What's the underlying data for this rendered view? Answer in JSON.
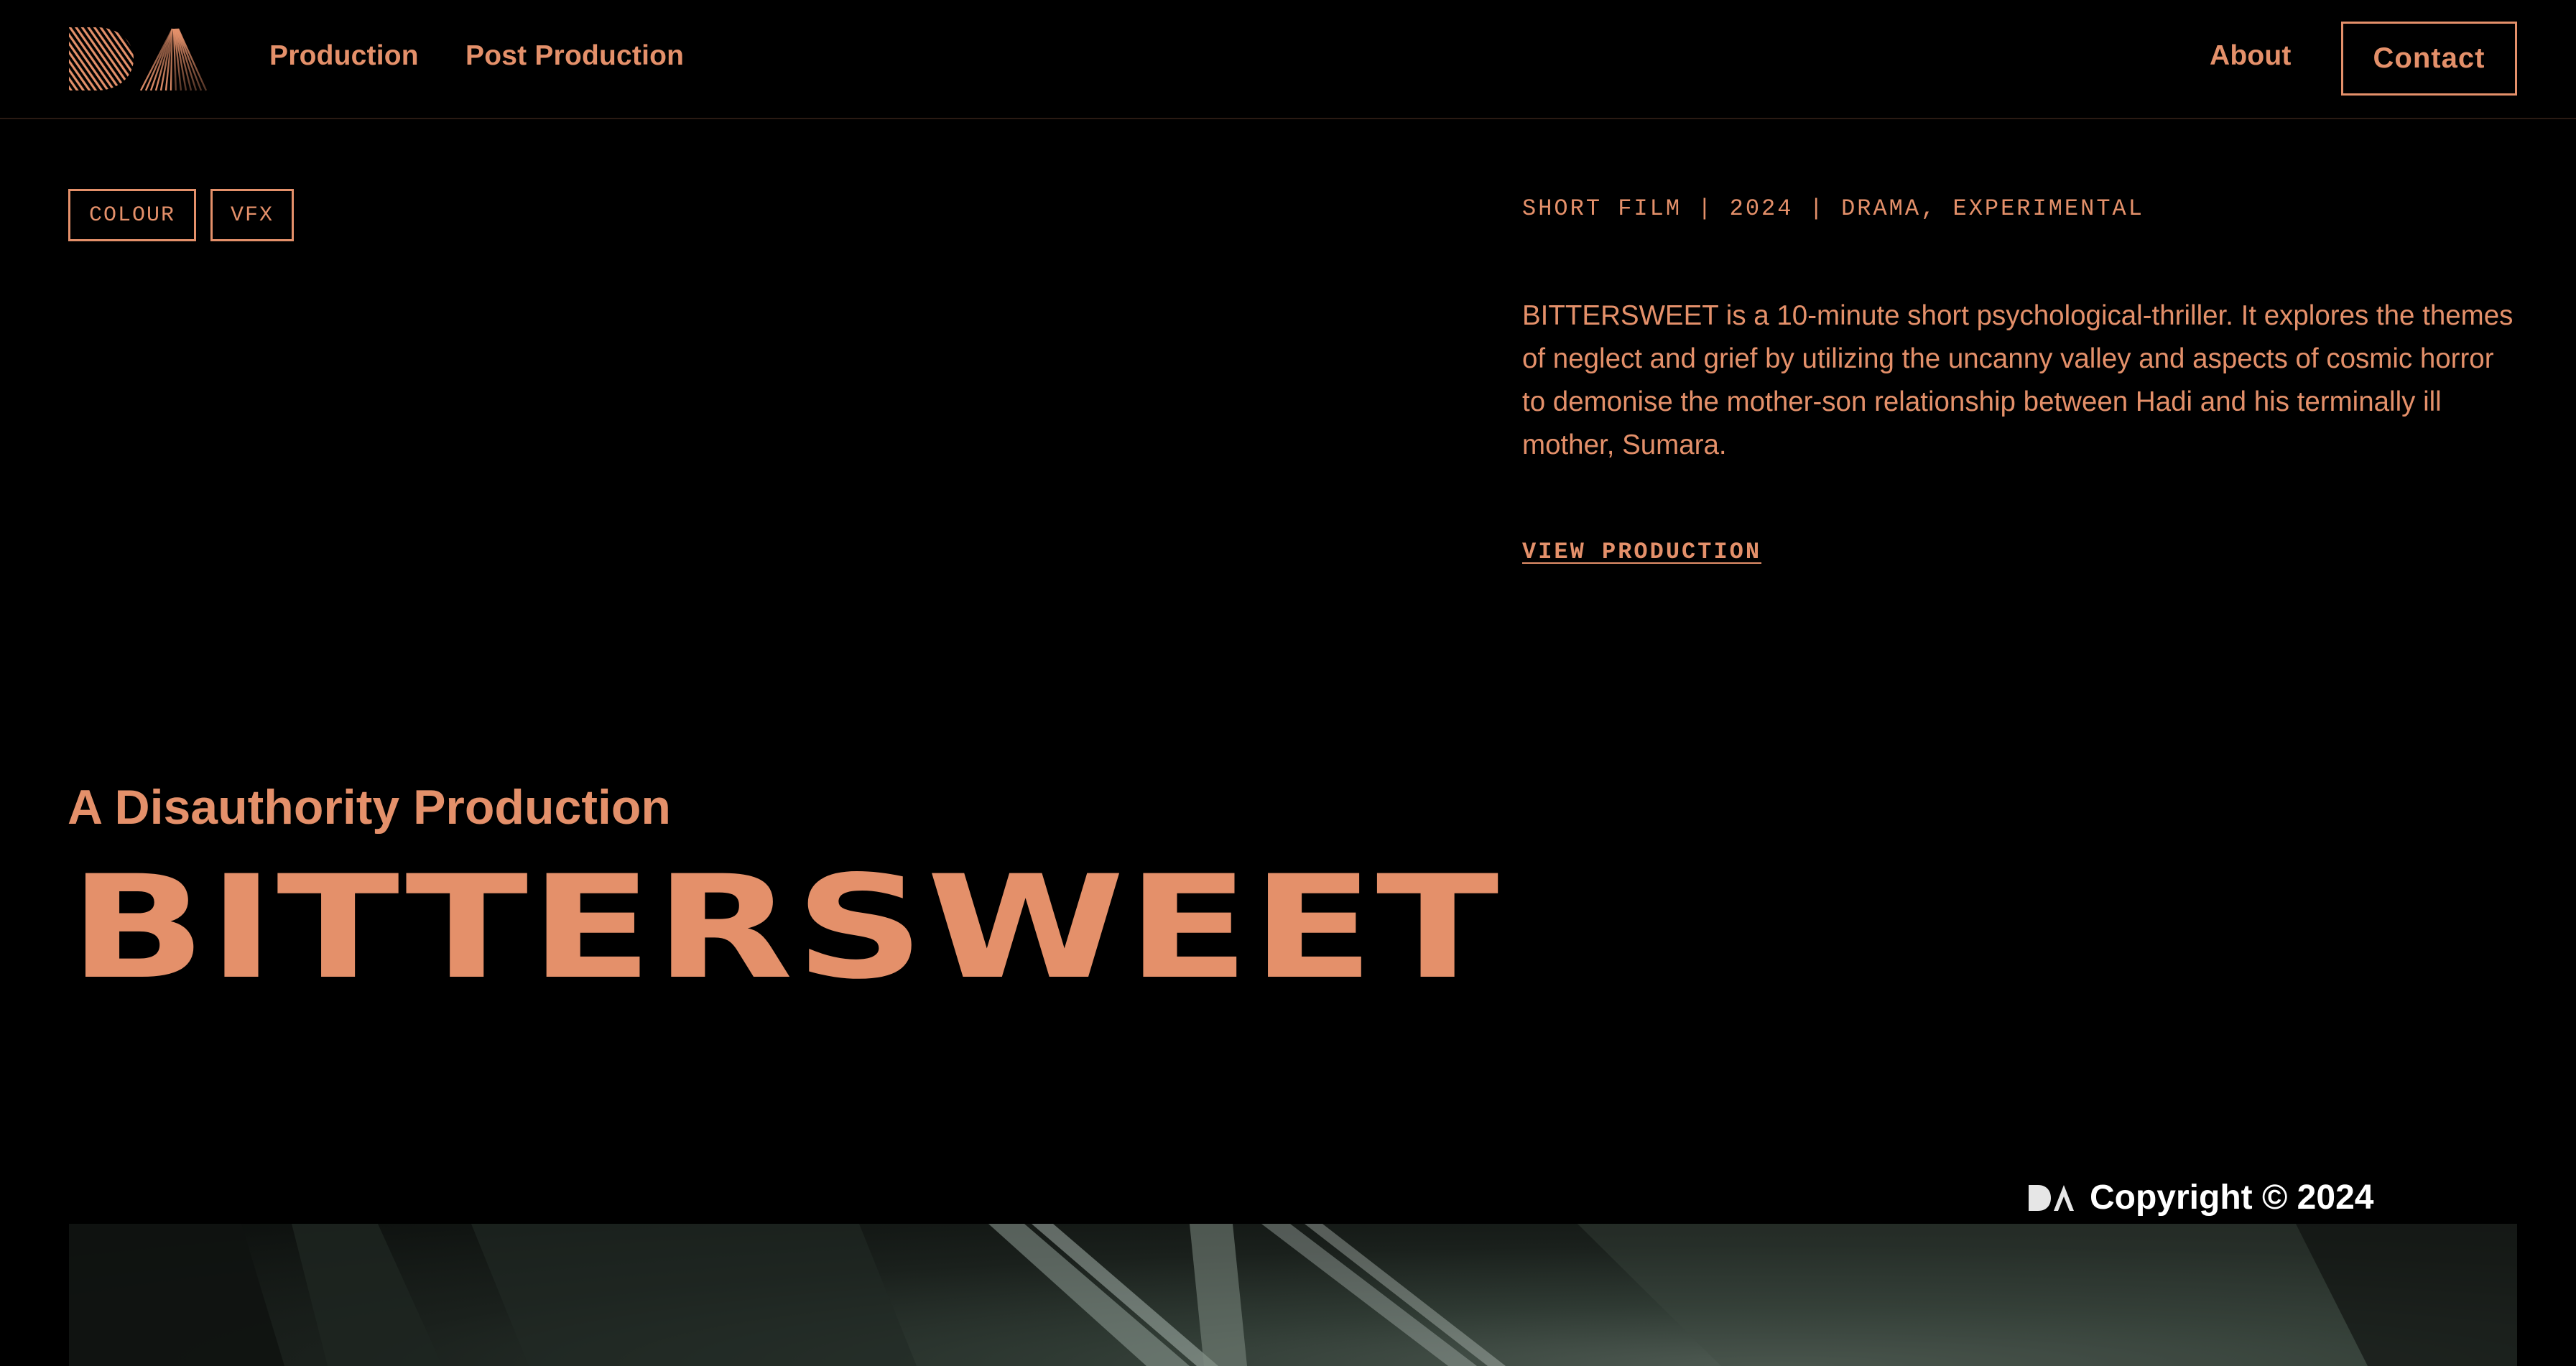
{
  "header": {
    "logo_icon": "da-logo-icon",
    "nav": [
      {
        "label": "Production"
      },
      {
        "label": "Post Production"
      }
    ],
    "about_label": "About",
    "contact_label": "Contact"
  },
  "tags": [
    "COLOUR",
    "VFX"
  ],
  "meta": "SHORT FILM | 2024 | DRAMA, EXPERIMENTAL",
  "description": "BITTERSWEET is a 10-minute short psychological-thriller. It explores the themes of neglect and grief by utilizing the uncanny valley and aspects of cosmic horror to demonise the mother-son relationship between Hadi and his terminally ill mother, Sumara.",
  "view_label": "VIEW PRODUCTION",
  "subtitle": "A Disauthority Production",
  "title": "BITTERSWEET",
  "copyright": {
    "icon": "da-logo-small-icon",
    "text": "Copyright © 2024"
  },
  "colors": {
    "accent": "#e4906a",
    "background": "#000000",
    "copyright": "#ffffff"
  }
}
